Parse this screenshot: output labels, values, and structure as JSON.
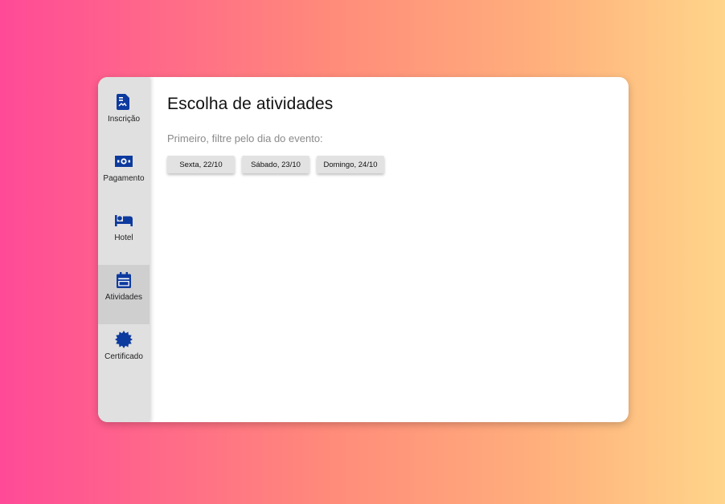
{
  "sidebar": {
    "items": [
      {
        "label": "Inscrição",
        "icon": "document-icon",
        "active": false
      },
      {
        "label": "Pagamento",
        "icon": "money-icon",
        "active": false
      },
      {
        "label": "Hotel",
        "icon": "bed-icon",
        "active": false
      },
      {
        "label": "Atividades",
        "icon": "calendar-icon",
        "active": true
      },
      {
        "label": "Certificado",
        "icon": "certificate-icon",
        "active": false
      }
    ]
  },
  "main": {
    "title": "Escolha de atividades",
    "subtitle": "Primeiro, filtre pelo dia do evento:",
    "days": [
      {
        "label": "Sexta, 22/10"
      },
      {
        "label": "Sábado, 23/10"
      },
      {
        "label": "Domingo, 24/10"
      }
    ]
  },
  "colors": {
    "icon_blue": "#0d3a9e",
    "sidebar_bg": "#e0e0e0",
    "sidebar_active_bg": "#cfcfcf",
    "button_bg": "#e2e2e2"
  }
}
